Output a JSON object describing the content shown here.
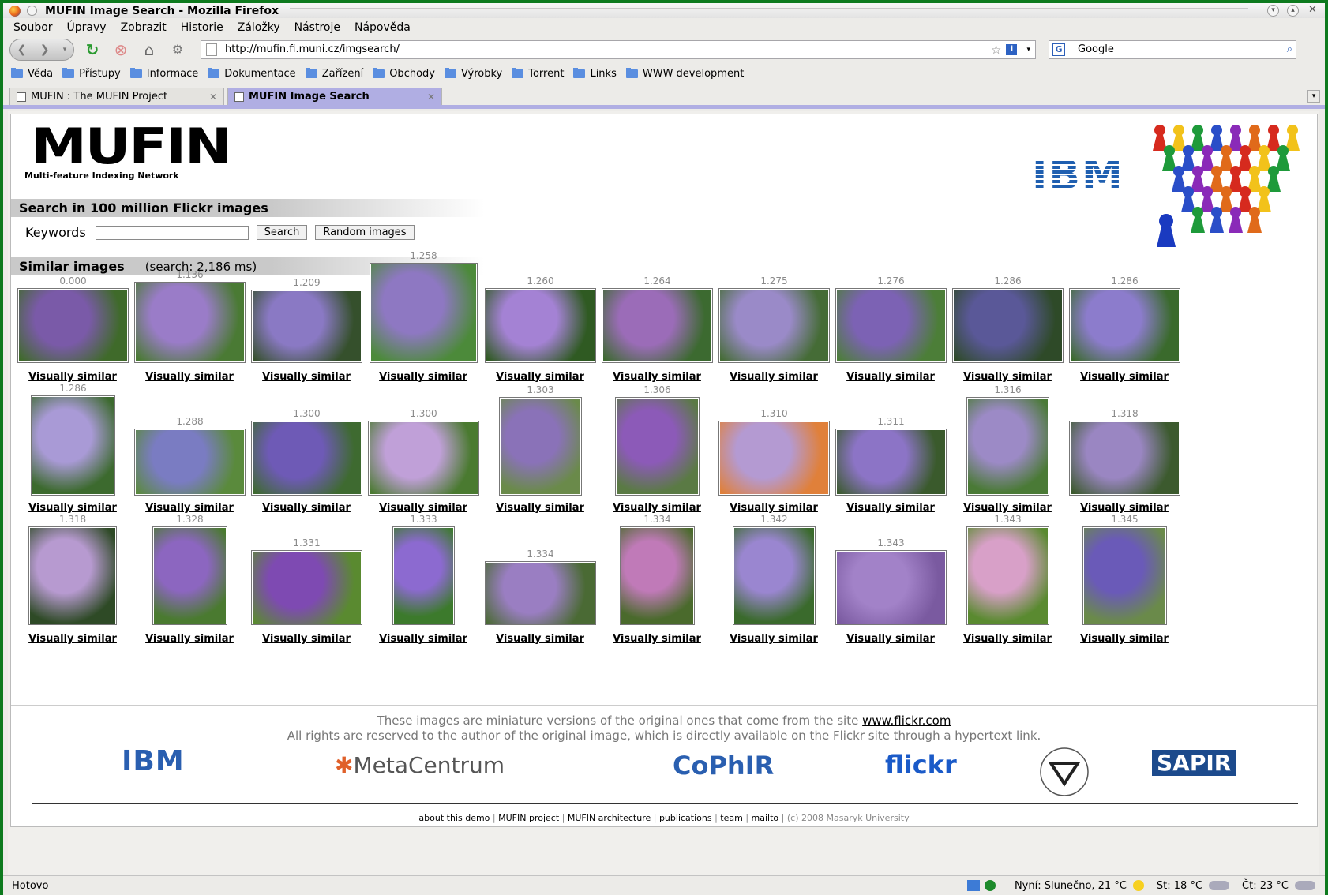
{
  "window": {
    "title": "MUFIN Image Search - Mozilla Firefox"
  },
  "menu": [
    "Soubor",
    "Úpravy",
    "Zobrazit",
    "Historie",
    "Záložky",
    "Nástroje",
    "Nápověda"
  ],
  "nav": {
    "url": "http://mufin.fi.muni.cz/imgsearch/",
    "search_value": "Google"
  },
  "bookmarks": [
    "Věda",
    "Přístupy",
    "Informace",
    "Dokumentace",
    "Zařízení",
    "Obchody",
    "Výrobky",
    "Torrent",
    "Links",
    "WWW development"
  ],
  "tabs": [
    {
      "label": "MUFIN : The MUFIN Project",
      "active": false
    },
    {
      "label": "MUFIN Image Search",
      "active": true
    }
  ],
  "page": {
    "logo_big": "MUFIN",
    "logo_sub": "Multi-feature Indexing Network",
    "ibm": "IBM",
    "search_header": "Search in 100 million Flickr images",
    "keywords_label": "Keywords",
    "keywords_value": "",
    "search_button": "Search",
    "random_button": "Random images",
    "similar_header": "Similar images",
    "similar_sub": "(search: 2,186 ms)",
    "link_text": "Visually similar",
    "rows": [
      [
        {
          "score": "0.000",
          "c1": "#7a5aa8",
          "c2": "#3f6a2a"
        },
        {
          "score": "1.136",
          "c1": "#9a7cc8",
          "c2": "#4a7a34"
        },
        {
          "score": "1.209",
          "c1": "#8a79c4",
          "c2": "#35502c"
        },
        {
          "score": "1.258",
          "c1": "#8e78c2",
          "c2": "#4c8a3a"
        },
        {
          "score": "1.260",
          "c1": "#a482d4",
          "c2": "#2f5a22"
        },
        {
          "score": "1.264",
          "c1": "#9b6cb8",
          "c2": "#3c6a30"
        },
        {
          "score": "1.275",
          "c1": "#9a8ac8",
          "c2": "#456c36"
        },
        {
          "score": "1.276",
          "c1": "#7c62b4",
          "c2": "#4c7e38"
        },
        {
          "score": "1.286",
          "c1": "#5a5898",
          "c2": "#2e4a28"
        },
        {
          "score": "1.286",
          "c1": "#8c7ccc",
          "c2": "#3a6a2c"
        }
      ],
      [
        {
          "score": "1.286",
          "c1": "#a99ad6",
          "c2": "#3c6a2e"
        },
        {
          "score": "1.288",
          "c1": "#7a7cc2",
          "c2": "#5a8a3c"
        },
        {
          "score": "1.300",
          "c1": "#6e5ab6",
          "c2": "#3e6a30"
        },
        {
          "score": "1.300",
          "c1": "#c0a0d8",
          "c2": "#4a7a30"
        },
        {
          "score": "1.303",
          "c1": "#8a72b8",
          "c2": "#6a8a4a"
        },
        {
          "score": "1.306",
          "c1": "#8c5ab8",
          "c2": "#5a7a44"
        },
        {
          "score": "1.310",
          "c1": "#b49ad2",
          "c2": "#e0803a"
        },
        {
          "score": "1.311",
          "c1": "#8c74c6",
          "c2": "#3a5a2c"
        },
        {
          "score": "1.316",
          "c1": "#9c8ac6",
          "c2": "#4a7a36"
        },
        {
          "score": "1.318",
          "c1": "#9a86c2",
          "c2": "#3c5a2e"
        }
      ],
      [
        {
          "score": "1.318",
          "c1": "#b79ad0",
          "c2": "#2e4a26"
        },
        {
          "score": "1.328",
          "c1": "#8c66c0",
          "c2": "#4a7a30"
        },
        {
          "score": "1.331",
          "c1": "#7e4ab2",
          "c2": "#5a8a30"
        },
        {
          "score": "1.333",
          "c1": "#8c6ad0",
          "c2": "#3c7a2c"
        },
        {
          "score": "1.334",
          "c1": "#9a7ec2",
          "c2": "#4a6a34"
        },
        {
          "score": "1.334",
          "c1": "#c07ab8",
          "c2": "#4a6a2c"
        },
        {
          "score": "1.342",
          "c1": "#9a86d0",
          "c2": "#3a6a2c"
        },
        {
          "score": "1.343",
          "c1": "#a282c8",
          "c2": "#7a5aa0"
        },
        {
          "score": "1.343",
          "c1": "#d8a0c8",
          "c2": "#5a8a30"
        },
        {
          "score": "1.345",
          "c1": "#6a5ab8",
          "c2": "#6a8a4a"
        }
      ]
    ],
    "footer_note_1": "These images are miniature versions of the original ones that come from the site",
    "footer_link": "www.flickr.com",
    "footer_note_2": "All rights are reserved to the author of the original image, which is directly available on the Flickr site through a hypertext link.",
    "partners": [
      "IBM",
      "MetaCentrum",
      "CoPhIR",
      "flickr",
      "SAPIR"
    ],
    "bottom_links": [
      "about this demo",
      "MUFIN project",
      "MUFIN architecture",
      "publications",
      "team",
      "mailto"
    ],
    "copyright": "(c) 2008 Masaryk University"
  },
  "status": {
    "text": "Hotovo",
    "weather_now": "Nyní: Slunečno, 21 °C",
    "weather_wed": "St: 18 °C",
    "weather_thu": "Čt: 23 °C"
  }
}
